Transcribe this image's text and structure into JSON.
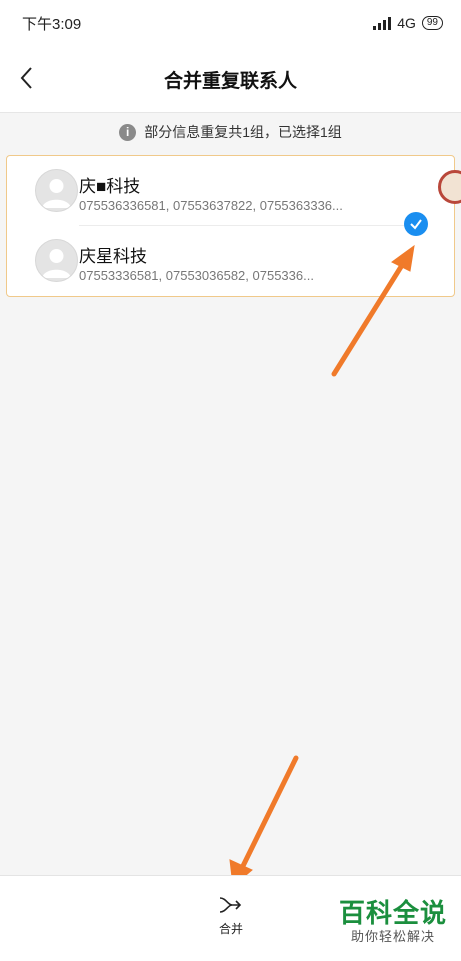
{
  "status_bar": {
    "time": "下午3:09",
    "network": "4G",
    "battery": "99"
  },
  "header": {
    "title": "合并重复联系人"
  },
  "info": {
    "text": "部分信息重复共1组，已选择1组"
  },
  "contacts": [
    {
      "name": "庆■科技",
      "phones": "075536336581, 07553637822, 0755363336..."
    },
    {
      "name": "庆星科技",
      "phones": "07553336581, 07553036582, 0755336..."
    }
  ],
  "bottom_bar": {
    "merge_label": "合并"
  },
  "watermark": {
    "title": "百科全说",
    "subtitle": "助你轻松解决"
  },
  "colors": {
    "accent_blue": "#1a8ef0",
    "annotation_arrow": "#f07a2a",
    "card_border": "#f0c98a",
    "watermark_green": "#1b8f3e"
  }
}
